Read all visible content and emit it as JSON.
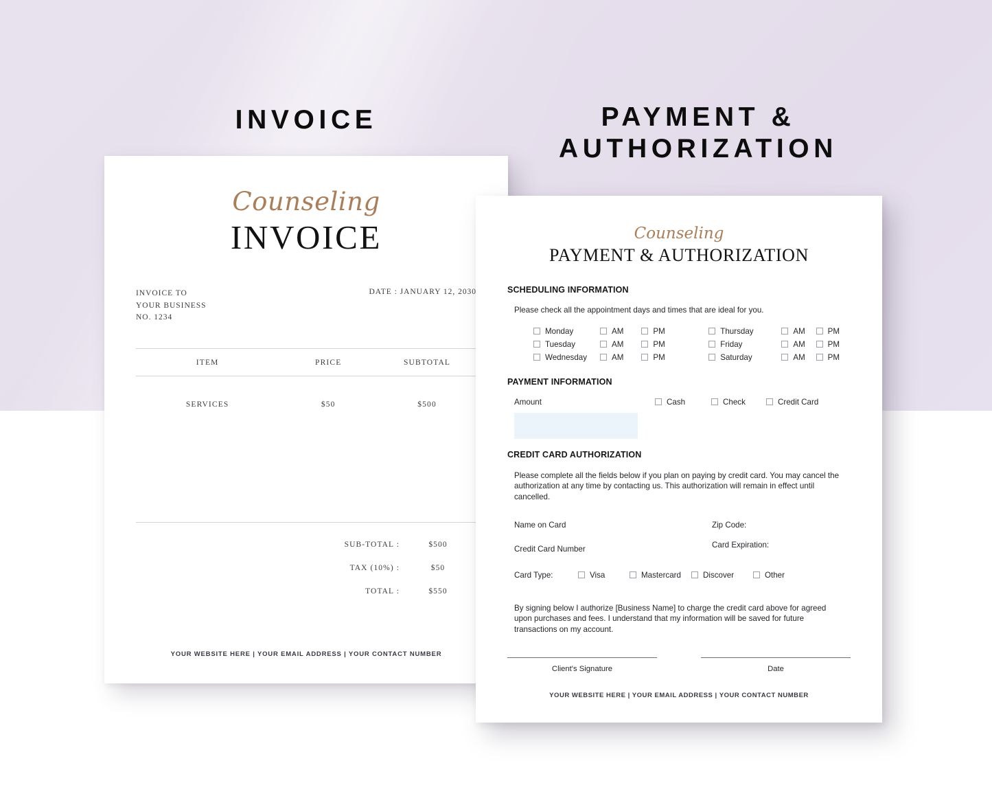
{
  "page": {
    "background_color": "#e6dfec",
    "accent_color": "#a97e58"
  },
  "banners": {
    "invoice": "INVOICE",
    "payment": "PAYMENT & AUTHORIZATION"
  },
  "invoice": {
    "script_word": "Counseling",
    "title": "INVOICE",
    "bill_to_label": "INVOICE TO",
    "bill_to_name": "YOUR BUSINESS",
    "bill_to_number": "NO. 1234",
    "date": "DATE : JANUARY 12, 2030",
    "table": {
      "headers": [
        "ITEM",
        "PRICE",
        "SUBTOTAL"
      ],
      "rows": [
        [
          "SERVICES",
          "$50",
          "$500"
        ]
      ]
    },
    "totals": [
      {
        "label": "SUB-TOTAL :",
        "value": "$500"
      },
      {
        "label": "TAX (10%) :",
        "value": "$50"
      },
      {
        "label": "TOTAL :",
        "value": "$550"
      }
    ],
    "footer": "YOUR WEBSITE HERE | YOUR EMAIL ADDRESS | YOUR CONTACT NUMBER"
  },
  "payment": {
    "script_word": "Counseling",
    "title": "PAYMENT & AUTHORIZATION",
    "scheduling": {
      "heading": "SCHEDULING INFORMATION",
      "instruction": "Please check all the appointment days and times that are ideal for you.",
      "rows": [
        {
          "day1": "Monday",
          "am1": "AM",
          "pm1": "PM",
          "day2": "Thursday",
          "am2": "AM",
          "pm2": "PM"
        },
        {
          "day1": "Tuesday",
          "am1": "AM",
          "pm1": "PM",
          "day2": "Friday",
          "am2": "AM",
          "pm2": "PM"
        },
        {
          "day1": "Wednesday",
          "am1": "AM",
          "pm1": "PM",
          "day2": "Saturday",
          "am2": "AM",
          "pm2": "PM"
        }
      ]
    },
    "payment_info": {
      "heading": "PAYMENT INFORMATION",
      "amount_label": "Amount",
      "amount_value": "",
      "amount_field_color": "#eaf4fa",
      "methods": [
        "Cash",
        "Check",
        "Credit Card"
      ]
    },
    "credit_card": {
      "heading": "CREDIT CARD AUTHORIZATION",
      "description": "Please complete all the fields below if you plan on paying by credit card. You may cancel the authorization at any time by contacting us. This authorization will remain in effect until cancelled.",
      "name_on_card_label": "Name on Card",
      "zip_code_label": "Zip Code:",
      "card_number_label": "Credit Card Number",
      "card_expiration_label": "Card Expiration:",
      "card_type_label": "Card Type:",
      "card_types": [
        "Visa",
        "Mastercard",
        "Discover",
        "Other"
      ]
    },
    "authorization_text": "By signing below I authorize [Business Name] to charge the credit card above for agreed upon purchases and fees. I understand that my information will be saved for future transactions on my account.",
    "signature_caption": "Client's Signature",
    "date_caption": "Date",
    "footer": "YOUR WEBSITE HERE | YOUR EMAIL ADDRESS | YOUR CONTACT NUMBER"
  }
}
